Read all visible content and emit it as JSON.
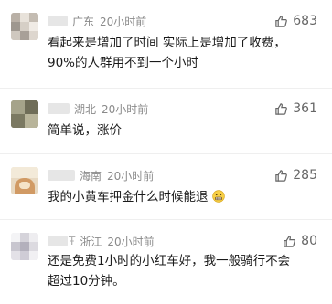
{
  "comments": [
    {
      "location": "广东",
      "time": "20小时前",
      "likes": "683",
      "lines": [
        "看起来是增加了时间 实际上是增加了收费，",
        "90%的人群用不到一个小时"
      ]
    },
    {
      "location": "湖北",
      "time": "20小时前",
      "likes": "361",
      "lines": [
        "简单说，涨价"
      ]
    },
    {
      "location": "海南",
      "time": "20小时前",
      "likes": "285",
      "lines": [
        "我的小黄车押金什么时候能退"
      ],
      "emoji": "grimace-emoji"
    },
    {
      "location": "浙江",
      "time": "20小时前",
      "likes": "80",
      "name_fragment": "Ŧ",
      "lines": [
        "还是免费1小时的小红车好，我一般骑行不会",
        "超过10分钟。"
      ]
    }
  ],
  "icons": {
    "like": "thumbs-up-icon"
  },
  "colors": {
    "meta_text": "#8a8a8a",
    "content_text": "#1a1a1a",
    "like_text": "#666666"
  }
}
